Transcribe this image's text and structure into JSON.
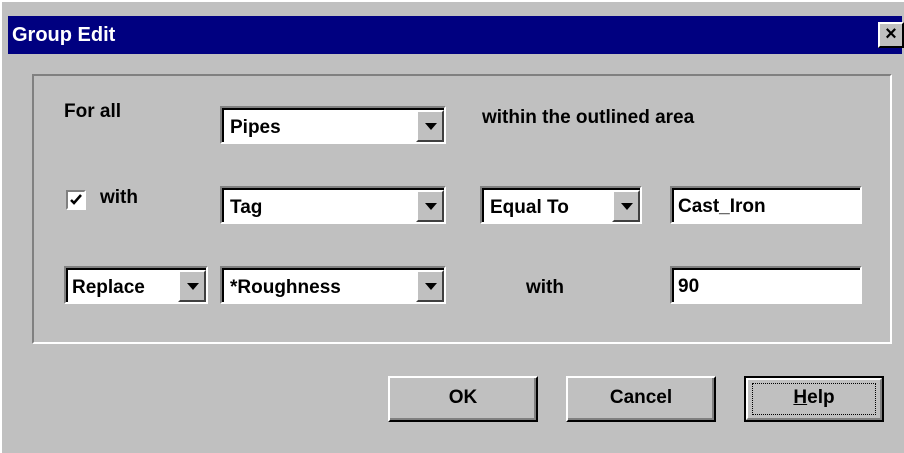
{
  "window": {
    "title": "Group Edit",
    "close_glyph": "×",
    "close_icon": "close-icon"
  },
  "row1": {
    "prefix": "For all",
    "object_select": "Pipes",
    "suffix": "within the outlined area"
  },
  "row2": {
    "checkbox_checked": true,
    "checkbox_label": "with",
    "property_select": "Tag",
    "operator_select": "Equal To",
    "value": "Cast_Iron"
  },
  "row3": {
    "action_select": "Replace",
    "property_select": "*Roughness",
    "with_label": "with",
    "value": "90"
  },
  "buttons": {
    "ok": "OK",
    "cancel": "Cancel",
    "help_prefix": "",
    "help_mnemonic": "H",
    "help_rest": "elp"
  },
  "colors": {
    "titlebar": "#000080",
    "face": "#c0c0c0"
  }
}
